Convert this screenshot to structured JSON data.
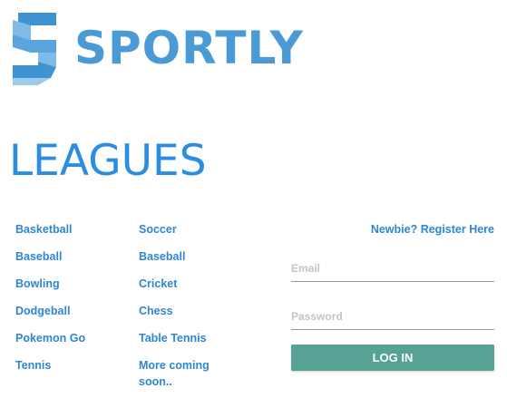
{
  "brand": {
    "name": "SPORTLY",
    "color": "#4a9ad6"
  },
  "logo_icon": "sportly-s-logo-icon",
  "page_title": "LEAGUES",
  "leagues": {
    "column_1": [
      "Basketball",
      "Baseball",
      "Bowling",
      "Dodgeball",
      "Pokemon Go",
      "Tennis"
    ],
    "column_2": [
      "Soccer",
      "Baseball",
      "Cricket",
      "Chess",
      "Table Tennis",
      "More coming soon.."
    ]
  },
  "login": {
    "register_label": "Newbie? Register Here",
    "email_placeholder": "Email",
    "password_placeholder": "Password",
    "login_label": "LOG IN",
    "button_color": "#56a295"
  },
  "colors": {
    "title": "#2b8de0",
    "link": "#2f86d2"
  }
}
